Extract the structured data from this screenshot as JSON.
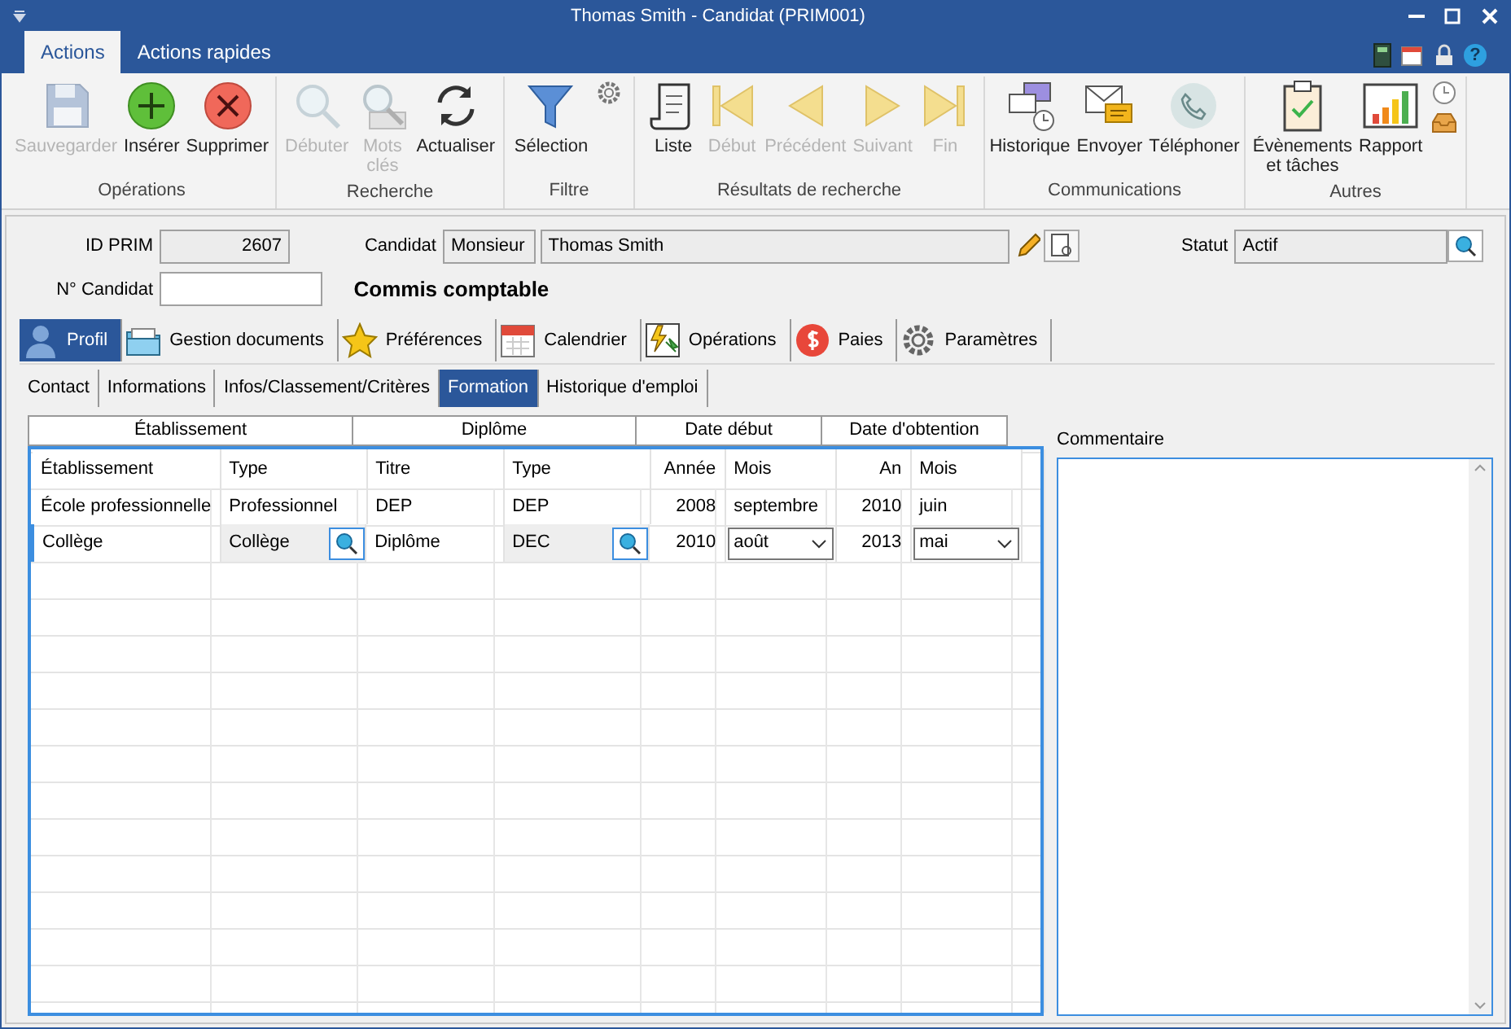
{
  "window": {
    "title": "Thomas Smith - Candidat (PRIM001)"
  },
  "ribbon_tabs": [
    {
      "label": "Actions",
      "selected": true
    },
    {
      "label": "Actions rapides",
      "selected": false
    }
  ],
  "help_button": "?",
  "ribbon_groups": [
    {
      "label": "Opérations",
      "buttons": [
        {
          "label": "Sauvegarder",
          "kind": "save",
          "disabled": true
        },
        {
          "label": "Insérer",
          "kind": "insert",
          "disabled": false
        },
        {
          "label": "Supprimer",
          "kind": "delete",
          "disabled": false
        }
      ]
    },
    {
      "label": "Recherche",
      "buttons": [
        {
          "label": "Débuter",
          "kind": "search",
          "disabled": true
        },
        {
          "label": "Mots clés",
          "kind": "keywords",
          "disabled": true
        },
        {
          "label": "Actualiser",
          "kind": "refresh",
          "disabled": false
        }
      ]
    },
    {
      "label": "Filtre",
      "buttons": [
        {
          "label": "Sélection",
          "kind": "filter",
          "disabled": false
        },
        {
          "kind": "gear"
        }
      ]
    },
    {
      "label": "Résultats de recherche",
      "buttons": [
        {
          "label": "Liste",
          "kind": "list",
          "disabled": false
        },
        {
          "label": "Début",
          "kind": "first",
          "disabled": true
        },
        {
          "label": "Précédent",
          "kind": "prev",
          "disabled": true
        },
        {
          "label": "Suivant",
          "kind": "next",
          "disabled": true
        },
        {
          "label": "Fin",
          "kind": "last",
          "disabled": true
        }
      ]
    },
    {
      "label": "Communications",
      "buttons": [
        {
          "label": "Historique",
          "kind": "history",
          "disabled": false
        },
        {
          "label": "Envoyer",
          "kind": "send",
          "disabled": false
        },
        {
          "label": "Téléphoner",
          "kind": "phone",
          "disabled": false
        }
      ]
    },
    {
      "label": "Autres",
      "buttons": [
        {
          "label": "Évènements et tâches",
          "kind": "tasks",
          "disabled": false
        },
        {
          "label": "Rapport",
          "kind": "report",
          "disabled": false
        },
        {
          "kind": "stack"
        }
      ]
    }
  ],
  "form": {
    "id_label": "ID PRIM",
    "id_value": "2607",
    "candidate_label": "Candidat",
    "civility": "Monsieur",
    "name": "Thomas Smith",
    "status_label": "Statut",
    "status": "Actif",
    "number_label": "N° Candidat",
    "job_title": "Commis comptable"
  },
  "main_tabs": [
    {
      "label": "Profil",
      "kind": "person",
      "selected": true
    },
    {
      "label": "Gestion documents",
      "kind": "folder",
      "selected": false
    },
    {
      "label": "Préférences",
      "kind": "star",
      "selected": false
    },
    {
      "label": "Calendrier",
      "kind": "calendar",
      "selected": false
    },
    {
      "label": "Opérations",
      "kind": "operations",
      "selected": false
    },
    {
      "label": "Paies",
      "kind": "dollar",
      "selected": false
    },
    {
      "label": "Paramètres",
      "kind": "gear",
      "selected": false
    }
  ],
  "sub_tabs": [
    {
      "label": "Contact",
      "selected": false
    },
    {
      "label": "Informations",
      "selected": false
    },
    {
      "label": "Infos/Classement/Critères",
      "selected": false
    },
    {
      "label": "Formation",
      "selected": true
    },
    {
      "label": "Historique d'emploi",
      "selected": false
    }
  ],
  "table": {
    "groups": [
      "Établissement",
      "Diplôme",
      "Date début",
      "Date d'obtention"
    ],
    "columns": [
      "Établissement",
      "Type",
      "Titre",
      "Type",
      "Année",
      "Mois",
      "An",
      "Mois"
    ],
    "rows": [
      {
        "selected": false,
        "cells": [
          {
            "kind": "text",
            "text": "École professionnelle"
          },
          {
            "kind": "text",
            "text": "Professionnel"
          },
          {
            "kind": "text",
            "text": "DEP"
          },
          {
            "kind": "text",
            "text": "DEP"
          },
          {
            "kind": "number",
            "text": "2008"
          },
          {
            "kind": "text",
            "text": "septembre"
          },
          {
            "kind": "number",
            "text": "2010"
          },
          {
            "kind": "text",
            "text": "juin"
          }
        ]
      },
      {
        "selected": true,
        "cells": [
          {
            "kind": "text",
            "text": "Collège"
          },
          {
            "kind": "lookup",
            "text": "Collège"
          },
          {
            "kind": "text",
            "text": "Diplôme"
          },
          {
            "kind": "lookup",
            "text": "DEC"
          },
          {
            "kind": "number",
            "text": "2010"
          },
          {
            "kind": "dropdown",
            "text": "août"
          },
          {
            "kind": "number",
            "text": "2013"
          },
          {
            "kind": "dropdown",
            "text": "mai"
          }
        ]
      }
    ]
  },
  "comment": {
    "label": "Commentaire"
  }
}
